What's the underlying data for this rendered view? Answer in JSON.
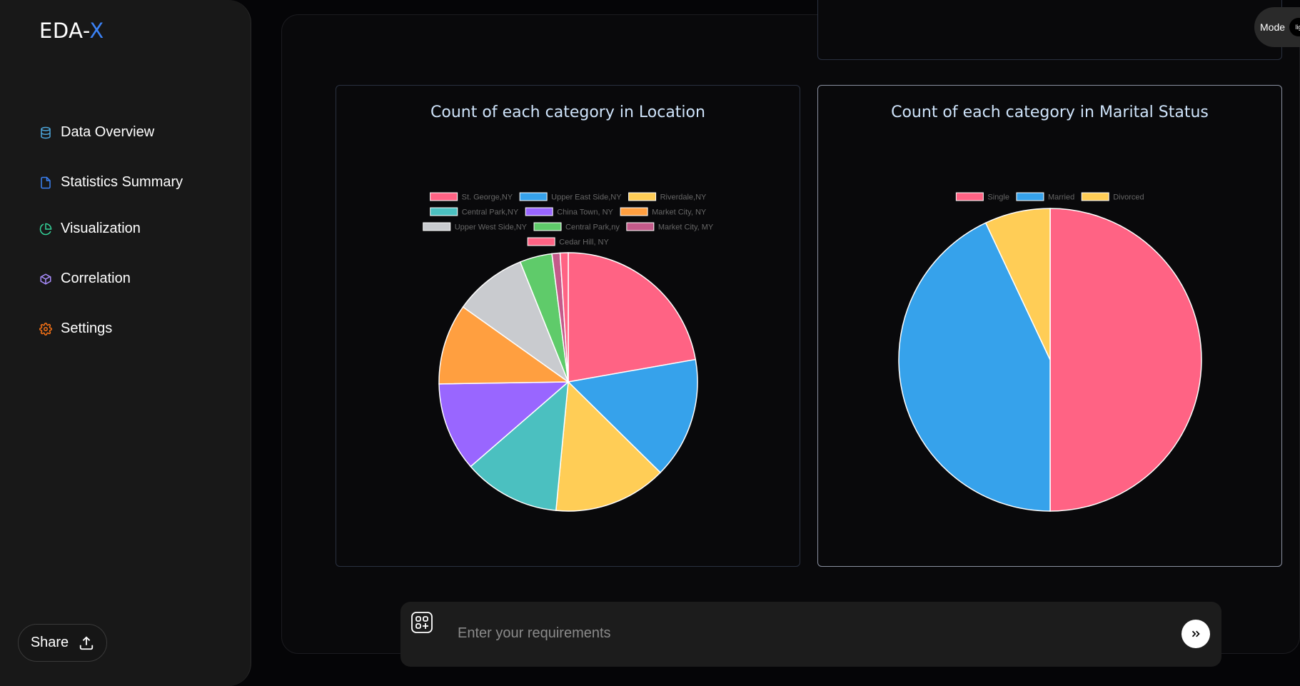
{
  "app": {
    "logo_main": "EDA-",
    "logo_accent": "X"
  },
  "sidebar": {
    "items": [
      {
        "label": "Data Overview",
        "icon": "database-icon",
        "color": "#4ea8de"
      },
      {
        "label": "Statistics Summary",
        "icon": "file-icon",
        "color": "#3b82f6"
      },
      {
        "label": "Visualization",
        "icon": "pie-chart-icon",
        "color": "#34d399"
      },
      {
        "label": "Correlation",
        "icon": "cube-icon",
        "color": "#a78bfa"
      },
      {
        "label": "Settings",
        "icon": "gear-icon",
        "color": "#f97316"
      }
    ],
    "share_label": "Share"
  },
  "mode": {
    "label": "Mode",
    "knob_text": "lig"
  },
  "input": {
    "placeholder": "Enter your requirements"
  },
  "chart_data": [
    {
      "type": "pie",
      "title": "Count of each category in Location",
      "legend_placement": "top",
      "categories": [
        "St. George,NY",
        "Upper East Side,NY",
        "Riverdale,NY",
        "Central Park,NY",
        "China Town, NY",
        "Market City, NY",
        "Upper West Side,NY",
        "Central Park,ny",
        "Market City, MY",
        "Cedar Hill, NY"
      ],
      "values": [
        22,
        15,
        14,
        12,
        11,
        10,
        9,
        4,
        1,
        1
      ],
      "colors": [
        "#ff6384",
        "#36a2eb",
        "#ffcd56",
        "#4bc0c0",
        "#9966ff",
        "#ff9f40",
        "#c9cbcf",
        "#5fcb6a",
        "#c45a8a",
        "#ff6384"
      ]
    },
    {
      "type": "pie",
      "title": "Count of each category in Marital Status",
      "legend_placement": "top",
      "categories": [
        "Single",
        "Married",
        "Divorced"
      ],
      "values": [
        50,
        43,
        7
      ],
      "colors": [
        "#ff6384",
        "#36a2eb",
        "#ffcd56"
      ]
    }
  ]
}
